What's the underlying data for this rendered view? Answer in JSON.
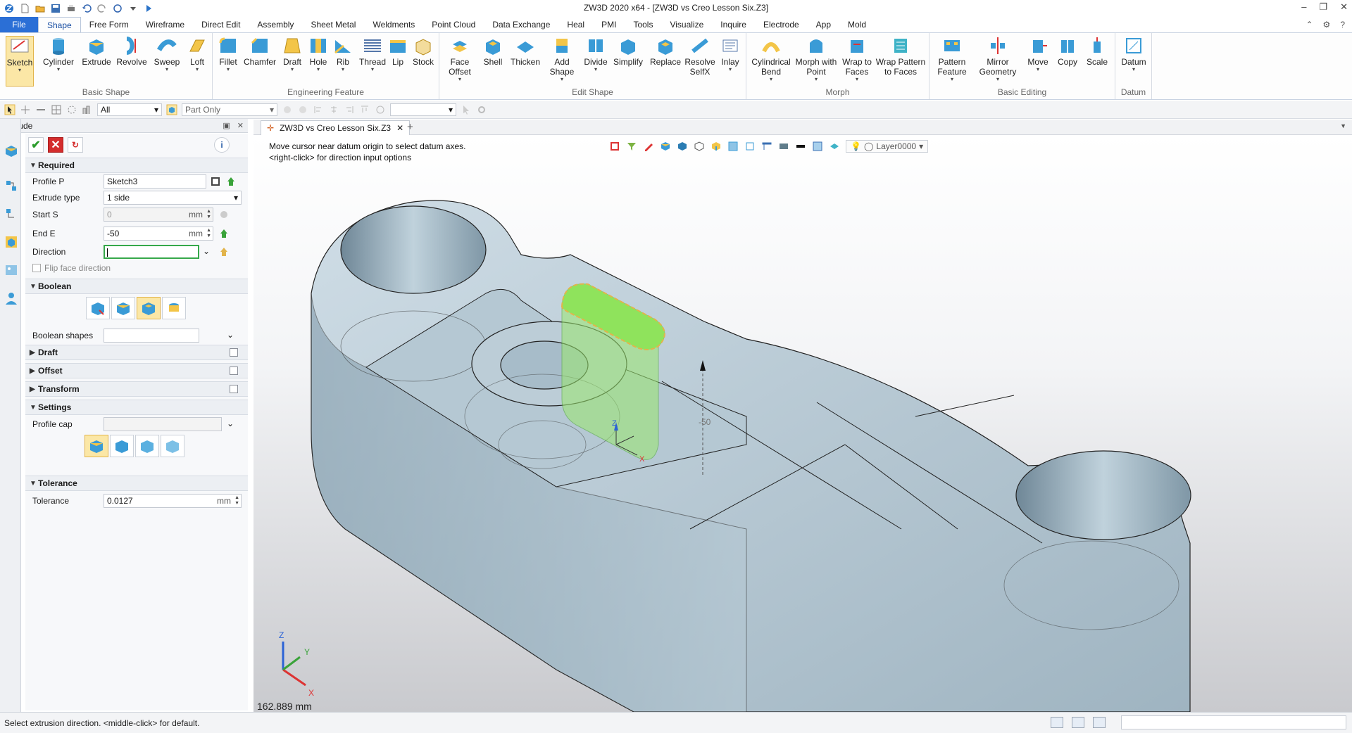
{
  "window": {
    "title": "ZW3D 2020 x64 - [ZW3D vs Creo Lesson Six.Z3]",
    "minimize": "–",
    "restore": "❐",
    "close": "✕"
  },
  "menu": {
    "file": "File",
    "tabs": [
      "Shape",
      "Free Form",
      "Wireframe",
      "Direct Edit",
      "Assembly",
      "Sheet Metal",
      "Weldments",
      "Point Cloud",
      "Data Exchange",
      "Heal",
      "PMI",
      "Tools",
      "Visualize",
      "Inquire",
      "Electrode",
      "App",
      "Mold"
    ],
    "active": "Shape"
  },
  "ribbon": {
    "groups": [
      {
        "name": "Basic Shape",
        "buttons": [
          "Sketch",
          "Cylinder",
          "Extrude",
          "Revolve",
          "Sweep",
          "Loft"
        ]
      },
      {
        "name": "Engineering Feature",
        "buttons": [
          "Fillet",
          "Chamfer",
          "Draft",
          "Hole",
          "Rib",
          "Thread",
          "Lip",
          "Stock"
        ]
      },
      {
        "name": "Edit Shape",
        "buttons": [
          "Face Offset",
          "Shell",
          "Thicken",
          "Add Shape",
          "Divide",
          "Simplify",
          "Replace",
          "Resolve SelfX",
          "Inlay"
        ]
      },
      {
        "name": "Morph",
        "buttons": [
          "Cylindrical Bend",
          "Morph with Point",
          "Wrap to Faces",
          "Wrap Pattern to Faces"
        ]
      },
      {
        "name": "Basic Editing",
        "buttons": [
          "Pattern Feature",
          "Mirror Geometry",
          "Move",
          "Copy",
          "Scale"
        ]
      },
      {
        "name": "Datum",
        "buttons": [
          "Datum"
        ]
      }
    ]
  },
  "toolbar": {
    "filter_value": "All",
    "scope_value": "Part Only"
  },
  "panel": {
    "header": "Extrude",
    "sections": {
      "required": "Required",
      "boolean": "Boolean",
      "draft": "Draft",
      "offset": "Offset",
      "transform": "Transform",
      "settings": "Settings",
      "tolerance": "Tolerance"
    },
    "fields": {
      "profile_label": "Profile P",
      "profile_value": "Sketch3",
      "extrude_type_label": "Extrude type",
      "extrude_type_value": "1 side",
      "start_label": "Start S",
      "start_value": "0",
      "start_unit": "mm",
      "end_label": "End E",
      "end_value": "-50",
      "end_unit": "mm",
      "direction_label": "Direction",
      "direction_value": "",
      "flip_label": "Flip face direction",
      "boolean_shapes_label": "Boolean shapes",
      "profile_cap_label": "Profile cap",
      "tolerance_label": "Tolerance",
      "tolerance_value": "0.0127",
      "tolerance_unit": "mm"
    }
  },
  "document": {
    "tab_title": "ZW3D vs Creo Lesson Six.Z3",
    "hint_line1": "Move cursor near datum origin to select datum axes.",
    "hint_line2": "<right-click> for direction input options",
    "layer": "Layer0000",
    "scale": "162.889 mm",
    "dim_label": "-50"
  },
  "status": {
    "message": "Select extrusion direction. <middle-click> for default."
  },
  "colors": {
    "accent": "#2b6fd6",
    "part": "#b8cbd6",
    "highlight": "#7fd96a",
    "selected_bg": "#fbe7a6"
  }
}
